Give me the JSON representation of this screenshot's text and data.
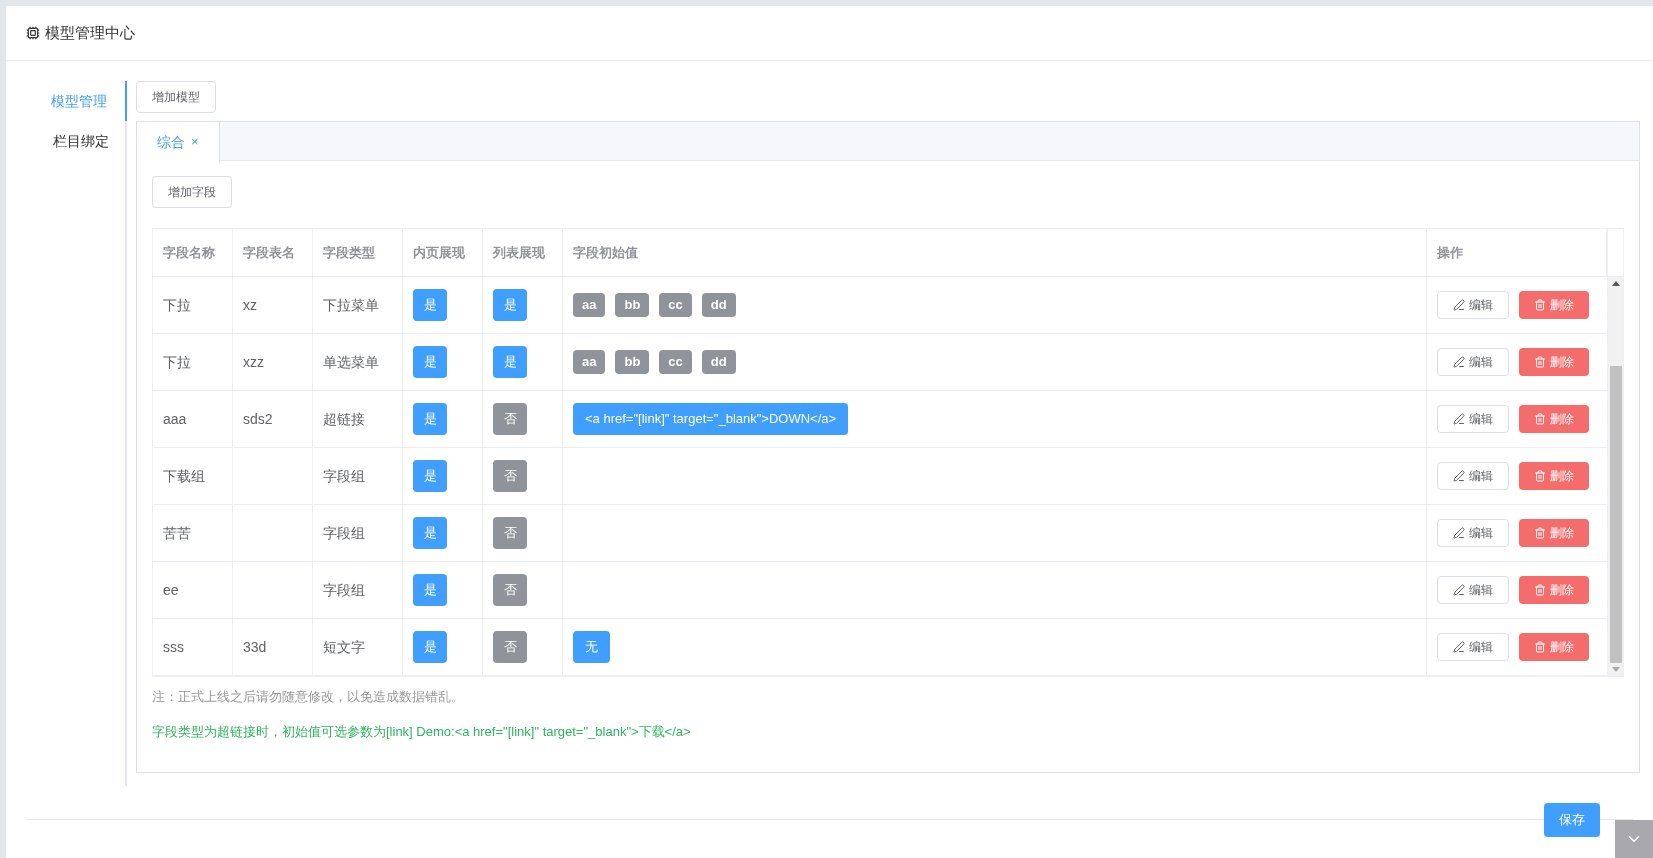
{
  "header": {
    "title": "模型管理中心"
  },
  "sidebar": {
    "items": [
      {
        "label": "模型管理",
        "selected": true
      },
      {
        "label": "栏目绑定",
        "selected": false
      }
    ]
  },
  "add_model_button": "增加模型",
  "tabs": [
    {
      "label": "综合",
      "selected": true,
      "close": "×"
    }
  ],
  "add_field_button": "增加字段",
  "table": {
    "columns": [
      "字段名称",
      "字段表名",
      "字段类型",
      "内页展现",
      "列表展现",
      "字段初始值",
      "操作"
    ],
    "rows": [
      {
        "name": "下拉",
        "table_name": "xz",
        "type": "下拉菜单",
        "inner": {
          "label": "是",
          "on": true
        },
        "list": {
          "label": "是",
          "on": true
        },
        "initial": [
          {
            "text": "aa",
            "kind": "option"
          },
          {
            "text": "bb",
            "kind": "option"
          },
          {
            "text": "cc",
            "kind": "option"
          },
          {
            "text": "dd",
            "kind": "option"
          }
        ],
        "edit": "编辑",
        "delete": "删除"
      },
      {
        "name": "下拉",
        "table_name": "xzz",
        "type": "单选菜单",
        "inner": {
          "label": "是",
          "on": true
        },
        "list": {
          "label": "是",
          "on": true
        },
        "initial": [
          {
            "text": "aa",
            "kind": "option"
          },
          {
            "text": "bb",
            "kind": "option"
          },
          {
            "text": "cc",
            "kind": "option"
          },
          {
            "text": "dd",
            "kind": "option"
          }
        ],
        "edit": "编辑",
        "delete": "删除"
      },
      {
        "name": "aaa",
        "table_name": "sds2",
        "type": "超链接",
        "inner": {
          "label": "是",
          "on": true
        },
        "list": {
          "label": "否",
          "on": false
        },
        "initial": [
          {
            "text": "<a href=\"[link]\" target=\"_blank\">DOWN</a>",
            "kind": "value"
          }
        ],
        "edit": "编辑",
        "delete": "删除"
      },
      {
        "name": "下载组",
        "type": "字段组",
        "inner": {
          "label": "是",
          "on": true
        },
        "list": {
          "label": "否",
          "on": false
        },
        "edit": "编辑",
        "delete": "删除"
      },
      {
        "name": "苦苦",
        "type": "字段组",
        "inner": {
          "label": "是",
          "on": true
        },
        "list": {
          "label": "否",
          "on": false
        },
        "edit": "编辑",
        "delete": "删除"
      },
      {
        "name": "ee",
        "type": "字段组",
        "inner": {
          "label": "是",
          "on": true
        },
        "list": {
          "label": "否",
          "on": false
        },
        "edit": "编辑",
        "delete": "删除"
      },
      {
        "name": "sss",
        "table_name": "33d",
        "type": "短文字",
        "inner": {
          "label": "是",
          "on": true
        },
        "list": {
          "label": "否",
          "on": false
        },
        "initial": [
          {
            "text": "无",
            "kind": "value"
          }
        ],
        "edit": "编辑",
        "delete": "删除"
      }
    ]
  },
  "note": "注：正式上线之后请勿随意修改，以免造成数据错乱。",
  "hint": "字段类型为超链接时，初始值可选参数为[link] Demo:<a href=\"[link]\" target=\"_blank\">下载</a>",
  "save_button": "保存"
}
